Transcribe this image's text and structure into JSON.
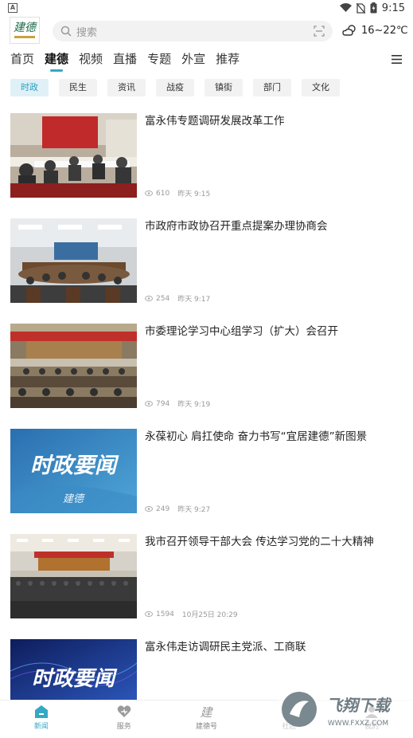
{
  "status_bar": {
    "badge": "A",
    "time": "9:15"
  },
  "header": {
    "search_placeholder": "搜索",
    "weather": "16~22℃"
  },
  "nav_tabs": [
    {
      "label": "首页"
    },
    {
      "label": "建德"
    },
    {
      "label": "视频"
    },
    {
      "label": "直播"
    },
    {
      "label": "专题"
    },
    {
      "label": "外宣"
    },
    {
      "label": "推荐"
    }
  ],
  "chips": [
    {
      "label": "时政"
    },
    {
      "label": "民生"
    },
    {
      "label": "资讯"
    },
    {
      "label": "战疫"
    },
    {
      "label": "镇街"
    },
    {
      "label": "部门"
    },
    {
      "label": "文化"
    }
  ],
  "news": [
    {
      "title": "富永伟专题调研发展改革工作",
      "views": "610",
      "time": "昨天 9:15"
    },
    {
      "title": "市政府市政协召开重点提案办理协商会",
      "views": "254",
      "time": "昨天 9:17"
    },
    {
      "title": "市委理论学习中心组学习（扩大）会召开",
      "views": "794",
      "time": "昨天 9:19"
    },
    {
      "title": "永葆初心 肩扛使命 奋力书写“宜居建德”新图景",
      "views": "249",
      "time": "昨天 9:27",
      "thumb_text": "时政要闻",
      "thumb_sub": "建德"
    },
    {
      "title": "我市召开领导干部大会 传达学习党的二十大精神",
      "views": "1594",
      "time": "10月25日 20:29"
    },
    {
      "title": "富永伟走访调研民主党派、工商联",
      "views": "",
      "time": "",
      "thumb_text": "时政要闻"
    }
  ],
  "tabbar": [
    {
      "label": "新闻"
    },
    {
      "label": "服务"
    },
    {
      "label": "建德号"
    },
    {
      "label": "社区"
    },
    {
      "label": "我的"
    }
  ],
  "watermark": {
    "text": "飞翔下载",
    "url": "WWW.FXXZ.COM"
  },
  "colors": {
    "accent": "#35a8c4",
    "chip_active_bg": "#dff1f7"
  }
}
